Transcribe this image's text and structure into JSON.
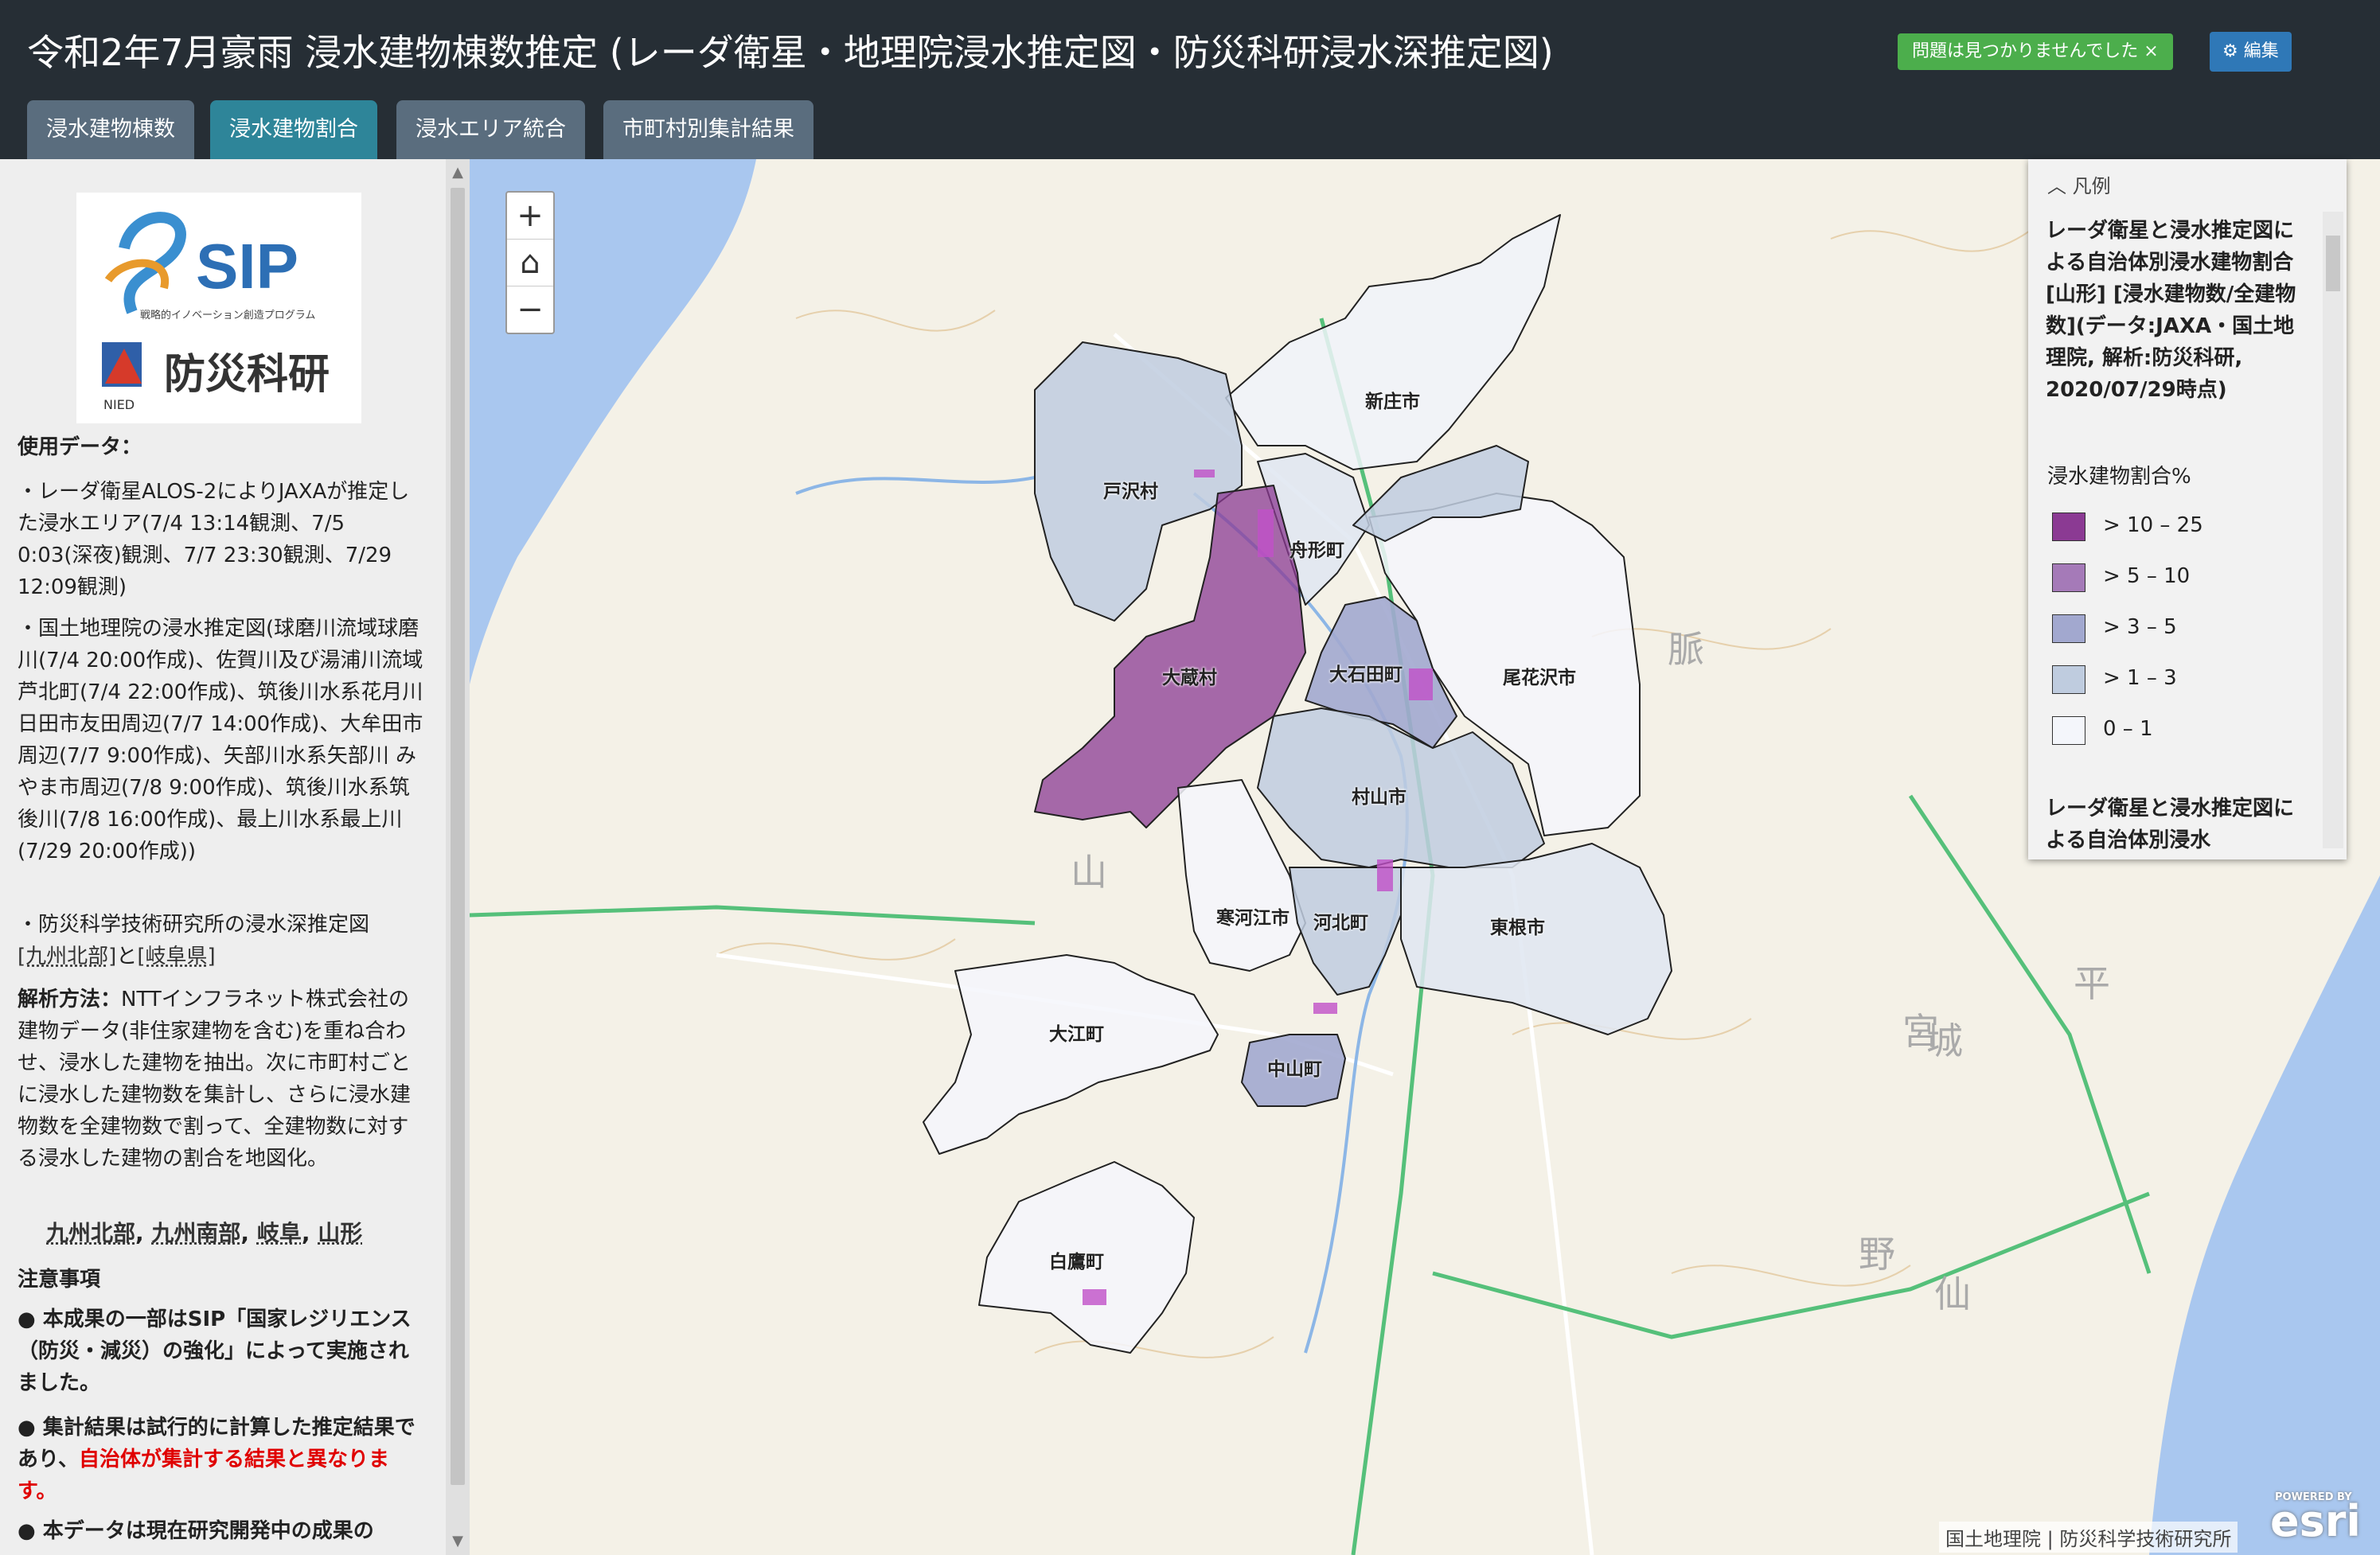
{
  "header": {
    "title": "令和2年7月豪雨 浸水建物棟数推定 (レーダ衛星・地理院浸水推定図・防災科研浸水深推定図)",
    "status_badge": "問題は見つかりませんでした ×",
    "edit_label": "⚙ 編集"
  },
  "tabs": [
    {
      "label": "浸水建物棟数",
      "active": false
    },
    {
      "label": "浸水建物割合",
      "active": true
    },
    {
      "label": "浸水エリア統合",
      "active": false
    },
    {
      "label": "市町村別集計結果",
      "active": false
    }
  ],
  "sidebar": {
    "logo_sip": "SIP",
    "logo_sip_sub": "戦略的イノベーション創造プログラム",
    "logo_nied": "防災科研",
    "logo_nied_sub": "NIED",
    "data_heading": "使用データ：",
    "data_item1": "・レーダ衛星ALOS-2によりJAXAが推定した浸水エリア(7/4 13:14観測、7/5 0:03(深夜)観測、7/7 23:30観測、7/29 12:09観測)",
    "data_item2": "・国土地理院の浸水推定図(球磨川流域球磨川(7/4 20:00作成)、佐賀川及び湯浦川流域芦北町(7/4 22:00作成)、筑後川水系花月川 日田市友田周辺(7/7 14:00作成)、大牟田市周辺(7/7 9:00作成)、矢部川水系矢部川 みやま市周辺(7/8 9:00作成)、筑後川水系筑後川(7/8 16:00作成)、最上川水系最上川(7/29 20:00作成))",
    "data_item3_prefix": "・防災科学技術研究所の浸水深推定図",
    "data_item3_link1": "[九州北部]",
    "data_item3_mid": "と",
    "data_item3_link2": "[岐阜県]",
    "method_heading": "解析方法：",
    "method_text": "NTTインフラネット株式会社の建物データ(非住家建物を含む)を重ね合わせ、浸水した建物を抽出。次に市町村ごとに浸水した建物数を集計し、さらに浸水建物数を全建物数で割って、全建物数に対する浸水した建物の割合を地図化。",
    "region_links": [
      "九州北部",
      "九州南部",
      "岐阜",
      "山形"
    ],
    "notes_heading": "注意事項",
    "note1": "● 本成果の一部はSIP「国家レジリエンス（防災・減災）の強化」によって実施されました。",
    "note2_prefix": "● 集計結果は試行的に計算した推定結果であり、",
    "note2_red": "自治体が集計する結果と異なります。",
    "note3": "● 本データは現在研究開発中の成果の"
  },
  "map": {
    "zoom_in": "+",
    "home": "⌂",
    "zoom_out": "−",
    "municipalities": [
      {
        "name": "新庄市",
        "value": 0.5
      },
      {
        "name": "戸沢村",
        "value": 2.0
      },
      {
        "name": "舟形町",
        "value": 1.5
      },
      {
        "name": "大蔵村",
        "value": 15.0
      },
      {
        "name": "大石田町",
        "value": 4.0
      },
      {
        "name": "尾花沢市",
        "value": 0.5
      },
      {
        "name": "村山市",
        "value": 2.0
      },
      {
        "name": "寒河江市",
        "value": 0.5
      },
      {
        "name": "河北町",
        "value": 2.0
      },
      {
        "name": "東根市",
        "value": 1.5
      },
      {
        "name": "大江町",
        "value": 0.5
      },
      {
        "name": "中山町",
        "value": 4.0
      },
      {
        "name": "白鷹町",
        "value": 0.5
      }
    ],
    "base_labels": {
      "big_yama": "山",
      "big_miya": "宮",
      "big_shiro": "城",
      "big_hira": "平",
      "big_no": "野",
      "big_sen": "仙",
      "big_myaku": "脈"
    }
  },
  "legend": {
    "header": "凡例",
    "title": "レーダ衛星と浸水推定図による自治体別浸水建物割合 [山形] [浸水建物数/全建物数](データ:JAXA・国土地理院, 解析:防災科研, 2020/07/29時点)",
    "subtitle": "浸水建物割合%",
    "classes": [
      {
        "label": "> 10 – 25",
        "color": "#8b3a93"
      },
      {
        "label": "> 5 – 10",
        "color": "#a57ab8"
      },
      {
        "label": "> 3 – 5",
        "color": "#a2a8cf"
      },
      {
        "label": "> 1 – 3",
        "color": "#bfccdf"
      },
      {
        "label": "0 – 1",
        "color": "#f4f6fb"
      }
    ],
    "title2": "レーダ衛星と浸水推定図による自治体別浸水"
  },
  "attribution": "国土地理院 | 防災科学技術研究所",
  "esri": "esri",
  "esri_powered": "POWERED BY"
}
